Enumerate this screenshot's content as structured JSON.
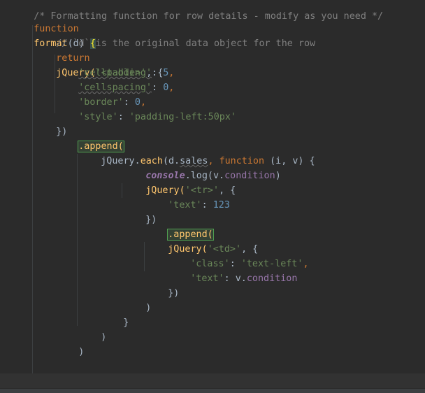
{
  "editor": {
    "language": "javascript",
    "colors": {
      "background": "#2b2b2b",
      "keyword": "#cc7832",
      "function": "#ffc66d",
      "string": "#6a8759",
      "number": "#6897bb",
      "comment": "#808080",
      "property": "#9876aa",
      "default": "#a9b7c6"
    },
    "lines": [
      {
        "comment": "/* Formatting function for row details - modify as you need */"
      },
      {
        "kw_function": "function",
        "name": "format",
        "params": "(d) ",
        "brace": "{"
      },
      {
        "comment": "// `d` is the original data object for the row"
      },
      {
        "kw_return": "return",
        "call": "jQuery(",
        "arg": "'<table>'",
        "rest": ", {"
      },
      {
        "key": "'cellpadding'",
        "sep": ": ",
        "value": "5",
        "end": ","
      },
      {
        "key": "'cellspacing'",
        "sep": ": ",
        "value": "0",
        "end": ","
      },
      {
        "key": "'border'",
        "sep": ": ",
        "value": "0",
        "end": ","
      },
      {
        "key": "'style'",
        "sep": ": ",
        "value": "'padding-left:50px'"
      },
      {
        "text": "})"
      },
      {
        "method": ".append("
      },
      {
        "pre": "jQuery.",
        "each": "each",
        "mid": "(d.",
        "prop": "sales",
        "comma": ", ",
        "kw_function": "function",
        "params": " (i, v) {"
      },
      {
        "console": "console",
        "rest": ".log(v.",
        "prop": "condition",
        "end": ")"
      },
      {
        "call": "jQuery(",
        "arg": "'<tr>'",
        "rest": ", {"
      },
      {
        "key": "'text'",
        "sep": ": ",
        "value": "123"
      },
      {
        "text": "})"
      },
      {
        "method": ".append("
      },
      {
        "call": "jQuery(",
        "arg": "'<td>'",
        "rest": ", {"
      },
      {
        "key": "'class'",
        "sep": ": ",
        "value": "'text-left'",
        "end": ","
      },
      {
        "key": "'text'",
        "sep": ": v.",
        "prop": "condition"
      },
      {
        "text": "})"
      },
      {
        "text": ")"
      },
      {
        "text": "}"
      },
      {
        "text": ")"
      },
      {
        "text": ")"
      },
      {
        "text": ""
      },
      {
        "text": ""
      },
      {
        "brace": "}"
      }
    ]
  }
}
